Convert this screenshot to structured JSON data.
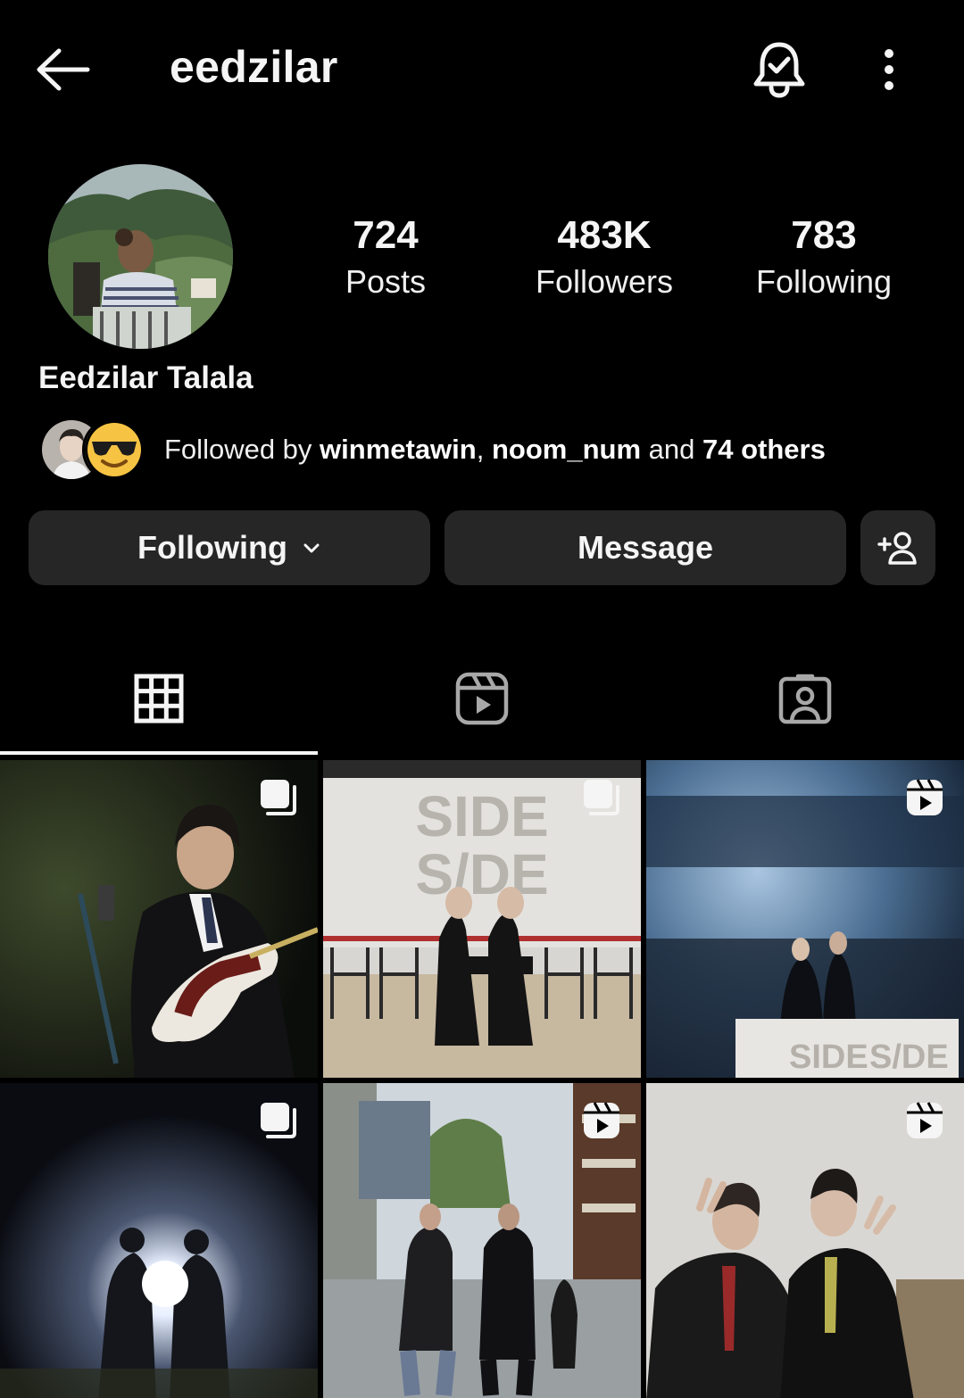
{
  "header": {
    "username": "eedzilar",
    "back_icon": "arrow-left-icon",
    "bell_icon": "bell-check-icon",
    "more_icon": "more-vertical-icon"
  },
  "profile": {
    "display_name": "Eedzilar Talala",
    "stats": [
      {
        "value": "724",
        "label": "Posts"
      },
      {
        "value": "483K",
        "label": "Followers"
      },
      {
        "value": "783",
        "label": "Following"
      }
    ],
    "followed_by": {
      "prefix": "Followed by ",
      "user1": "winmetawin",
      "sep": ", ",
      "user2": "noom_num",
      "and": " and ",
      "others": "74 others"
    }
  },
  "actions": {
    "following_label": "Following",
    "message_label": "Message",
    "add_user_icon": "add-person-icon"
  },
  "tabs": [
    {
      "name": "posts-grid",
      "icon": "grid-icon",
      "selected": true
    },
    {
      "name": "reels",
      "icon": "reels-icon",
      "selected": false
    },
    {
      "name": "tagged",
      "icon": "tagged-person-icon",
      "selected": false
    }
  ],
  "posts": [
    {
      "type": "carousel",
      "badge_icon": "carousel-icon"
    },
    {
      "type": "carousel",
      "badge_icon": "carousel-icon"
    },
    {
      "type": "reel",
      "badge_icon": "reel-icon"
    },
    {
      "type": "carousel",
      "badge_icon": "carousel-icon"
    },
    {
      "type": "reel",
      "badge_icon": "reel-icon"
    },
    {
      "type": "reel",
      "badge_icon": "reel-icon"
    }
  ],
  "colors": {
    "background": "#000000",
    "button_bg": "#262626",
    "text": "#f5f5f5"
  }
}
